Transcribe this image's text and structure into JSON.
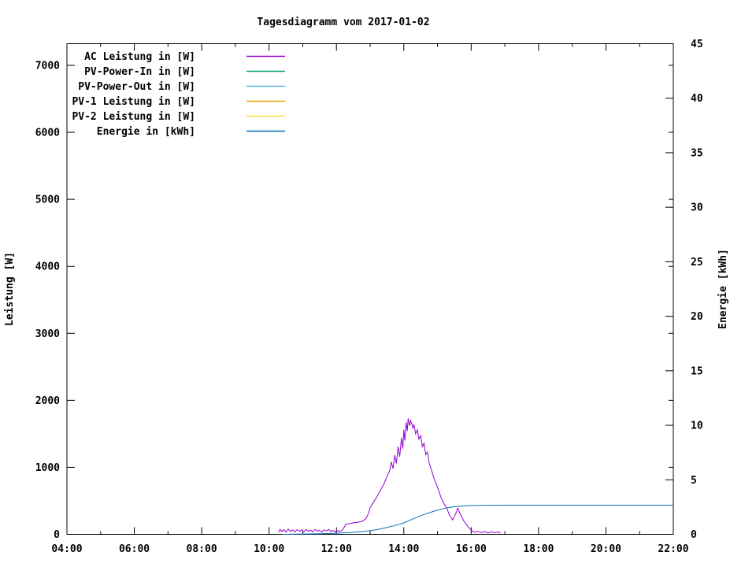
{
  "title": "Tagesdiagramm vom 2017-01-02",
  "chart_data": {
    "type": "line",
    "title": "Tagesdiagramm vom 2017-01-02",
    "background": "#ffffff",
    "frame_color": "#000000",
    "x_axis": {
      "range_hours": [
        4,
        22
      ],
      "major_tick_labels": [
        "04:00",
        "06:00",
        "08:00",
        "10:00",
        "12:00",
        "14:00",
        "16:00",
        "18:00",
        "20:00",
        "22:00"
      ],
      "major_every_hours": 2,
      "minor_every_hours": 1
    },
    "y_left": {
      "label": "Leistung [W]",
      "tick_labels": [
        "0",
        "1000",
        "2000",
        "3000",
        "4000",
        "5000",
        "6000",
        "7000"
      ],
      "tick_values": [
        0,
        1000,
        2000,
        3000,
        4000,
        5000,
        6000,
        7000
      ],
      "range": [
        0,
        7323
      ]
    },
    "y_right": {
      "label": "Energie [kWh]",
      "tick_labels": [
        "0",
        "5",
        "10",
        "15",
        "20",
        "25",
        "30",
        "35",
        "40",
        "45"
      ],
      "tick_values": [
        0,
        5,
        10,
        15,
        20,
        25,
        30,
        35,
        40,
        45
      ],
      "range": [
        0,
        45
      ]
    },
    "legend_position": "top-left-inside",
    "grid": false,
    "series": [
      {
        "name": "AC Leistung in [W]",
        "color": "#9400d3",
        "axis": "left",
        "points": [
          [
            10.28,
            30
          ],
          [
            10.33,
            75
          ],
          [
            10.38,
            40
          ],
          [
            10.43,
            70
          ],
          [
            10.5,
            35
          ],
          [
            10.57,
            78
          ],
          [
            10.63,
            45
          ],
          [
            10.7,
            65
          ],
          [
            10.77,
            38
          ],
          [
            10.83,
            72
          ],
          [
            10.9,
            42
          ],
          [
            10.97,
            68
          ],
          [
            11.03,
            35
          ],
          [
            11.1,
            70
          ],
          [
            11.17,
            45
          ],
          [
            11.23,
            62
          ],
          [
            11.3,
            38
          ],
          [
            11.37,
            72
          ],
          [
            11.43,
            48
          ],
          [
            11.5,
            60
          ],
          [
            11.57,
            32
          ],
          [
            11.63,
            68
          ],
          [
            11.7,
            50
          ],
          [
            11.77,
            73
          ],
          [
            11.83,
            42
          ],
          [
            11.9,
            58
          ],
          [
            11.97,
            35
          ],
          [
            12.03,
            55
          ],
          [
            12.1,
            42
          ],
          [
            12.17,
            60
          ],
          [
            12.22,
            95
          ],
          [
            12.28,
            150
          ],
          [
            12.38,
            160
          ],
          [
            12.5,
            172
          ],
          [
            12.62,
            180
          ],
          [
            12.75,
            190
          ],
          [
            12.87,
            230
          ],
          [
            12.95,
            310
          ],
          [
            13.0,
            400
          ],
          [
            13.1,
            480
          ],
          [
            13.2,
            560
          ],
          [
            13.3,
            650
          ],
          [
            13.4,
            740
          ],
          [
            13.5,
            860
          ],
          [
            13.58,
            950
          ],
          [
            13.63,
            1080
          ],
          [
            13.68,
            980
          ],
          [
            13.73,
            1180
          ],
          [
            13.78,
            1060
          ],
          [
            13.83,
            1310
          ],
          [
            13.88,
            1160
          ],
          [
            13.93,
            1440
          ],
          [
            13.97,
            1280
          ],
          [
            14.0,
            1560
          ],
          [
            14.03,
            1400
          ],
          [
            14.07,
            1670
          ],
          [
            14.1,
            1540
          ],
          [
            14.13,
            1730
          ],
          [
            14.17,
            1620
          ],
          [
            14.2,
            1700
          ],
          [
            14.23,
            1660
          ],
          [
            14.27,
            1590
          ],
          [
            14.3,
            1640
          ],
          [
            14.35,
            1500
          ],
          [
            14.4,
            1560
          ],
          [
            14.45,
            1420
          ],
          [
            14.5,
            1470
          ],
          [
            14.55,
            1310
          ],
          [
            14.6,
            1360
          ],
          [
            14.65,
            1190
          ],
          [
            14.7,
            1230
          ],
          [
            14.75,
            1070
          ],
          [
            14.82,
            960
          ],
          [
            14.9,
            830
          ],
          [
            15.0,
            700
          ],
          [
            15.1,
            560
          ],
          [
            15.2,
            450
          ],
          [
            15.27,
            400
          ],
          [
            15.35,
            290
          ],
          [
            15.45,
            215
          ],
          [
            15.55,
            320
          ],
          [
            15.6,
            390
          ],
          [
            15.68,
            300
          ],
          [
            15.78,
            200
          ],
          [
            15.88,
            130
          ],
          [
            16.0,
            62
          ],
          [
            16.1,
            30
          ],
          [
            16.2,
            46
          ],
          [
            16.3,
            24
          ],
          [
            16.4,
            42
          ],
          [
            16.5,
            20
          ],
          [
            16.6,
            38
          ],
          [
            16.7,
            22
          ],
          [
            16.8,
            36
          ],
          [
            16.87,
            18
          ]
        ]
      },
      {
        "name": "PV-Power-In in [W]",
        "color": "#009e73",
        "axis": "left",
        "points": []
      },
      {
        "name": "PV-Power-Out in [W]",
        "color": "#56b4e9",
        "axis": "left",
        "points": []
      },
      {
        "name": "PV-1 Leistung in [W]",
        "color": "#e69f00",
        "axis": "left",
        "points": []
      },
      {
        "name": "PV-2 Leistung in [W]",
        "color": "#f0e442",
        "axis": "left",
        "points": []
      },
      {
        "name": "Energie in [kWh]",
        "color": "#0072b2",
        "axis": "right",
        "points": [
          [
            10.4,
            0
          ],
          [
            11.0,
            0.03
          ],
          [
            11.5,
            0.06
          ],
          [
            12.0,
            0.1
          ],
          [
            12.4,
            0.16
          ],
          [
            12.8,
            0.26
          ],
          [
            13.1,
            0.38
          ],
          [
            13.4,
            0.55
          ],
          [
            13.7,
            0.78
          ],
          [
            14.0,
            1.05
          ],
          [
            14.3,
            1.45
          ],
          [
            14.6,
            1.82
          ],
          [
            14.9,
            2.12
          ],
          [
            15.1,
            2.3
          ],
          [
            15.3,
            2.44
          ],
          [
            15.5,
            2.53
          ],
          [
            15.7,
            2.59
          ],
          [
            15.9,
            2.63
          ],
          [
            16.2,
            2.65
          ],
          [
            16.6,
            2.66
          ],
          [
            17.0,
            2.67
          ],
          [
            18.0,
            2.67
          ],
          [
            20.0,
            2.67
          ],
          [
            22.0,
            2.67
          ]
        ]
      }
    ]
  }
}
